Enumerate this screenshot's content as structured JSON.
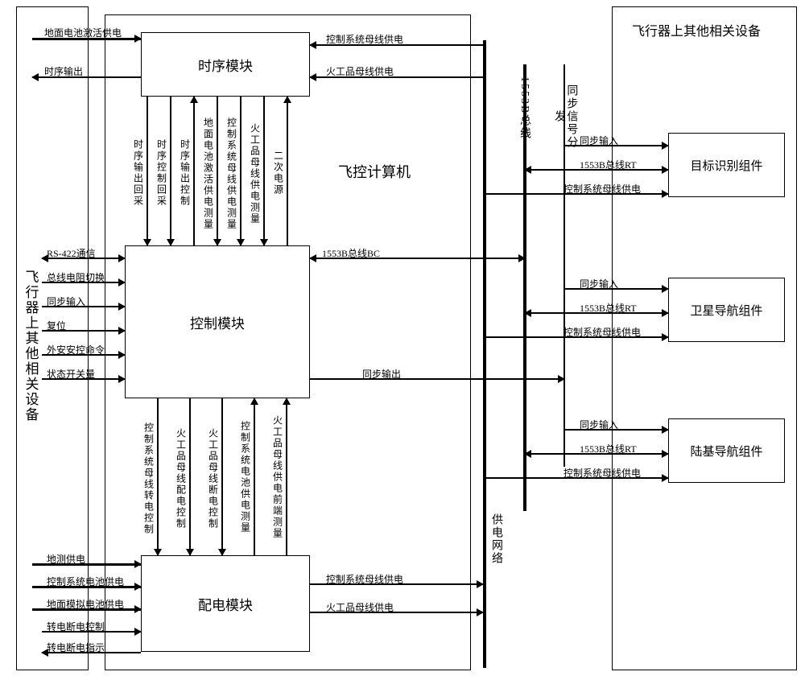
{
  "left_panel_label": "飞行器上其他相关设备",
  "right_panel_label": "飞行器上其他相关设备",
  "center_label": "飞控计算机",
  "modules": {
    "timing": "时序模块",
    "control": "控制模块",
    "power": "配电模块"
  },
  "right_boxes": {
    "target": "目标识别组件",
    "satnav": "卫星导航组件",
    "groundnav": "陆基导航组件"
  },
  "buses": {
    "bus_1553b": "1553B总线",
    "sync_dist": "同步信号分发",
    "power_net": "供电网络"
  },
  "timing_left": {
    "ground_batt": "地面电池激活供电",
    "timing_out": "时序输出"
  },
  "timing_right": {
    "ctrl_bus_power": "控制系统母线供电",
    "pyro_bus_power": "火工品母线供电"
  },
  "timing_ctrl_links": {
    "a": "时序输出回采",
    "b": "时序控制回采",
    "c": "时序输出控制",
    "d": "地面电池激活供电测量",
    "e": "控制系统母线供电测量",
    "f": "火工品母线供电测量",
    "g": "二次电源"
  },
  "ctrl_left": {
    "rs422": "RS-422通信",
    "bus_r_sw": "总线电阻切换",
    "sync_in": "同步输入",
    "reset": "复位",
    "ext_safe": "外安安控命令",
    "state_sw": "状态开关量"
  },
  "ctrl_right": {
    "bus_bc": "1553B总线BC",
    "sync_out": "同步输出"
  },
  "ctrl_power_links": {
    "a": "控制系统母线转电控制",
    "b": "火工品母线配电控制",
    "c": "火工品母线断电控制",
    "d": "控制系统电池供电测量",
    "e": "火工品母线供电前端测量"
  },
  "power_left": {
    "gnd_test": "地测供电",
    "ctrl_batt": "控制系统电池供电",
    "gnd_sim_batt": "地面模拟电池供电",
    "sw_off_ctrl": "转电断电控制",
    "sw_off_ind": "转电断电指示"
  },
  "power_right": {
    "ctrl_bus": "控制系统母线供电",
    "pyro_bus": "火工品母线供电"
  },
  "right_signals": {
    "sync_in": "同步输入",
    "bus_rt": "1553B总线RT",
    "ctrl_bus_power": "控制系统母线供电"
  }
}
